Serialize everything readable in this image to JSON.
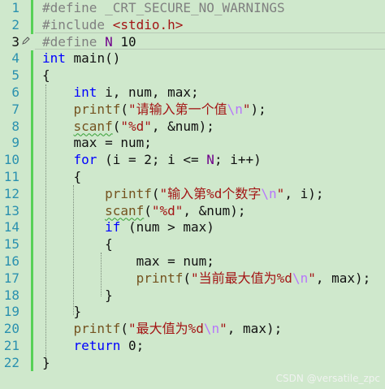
{
  "editor": {
    "line_numbers": [
      "1",
      "2",
      "3",
      "4",
      "5",
      "6",
      "7",
      "8",
      "9",
      "10",
      "11",
      "12",
      "13",
      "14",
      "15",
      "16",
      "17",
      "18",
      "19",
      "20",
      "21",
      "22"
    ],
    "active_line": 3,
    "lines": [
      [
        {
          "t": "#define _CRT_SECURE_NO_WARNINGS",
          "c": "pp"
        }
      ],
      [
        {
          "t": "#include ",
          "c": "pp"
        },
        {
          "t": "<stdio.h>",
          "c": "str"
        }
      ],
      [
        {
          "t": "#define ",
          "c": "pp"
        },
        {
          "t": "N",
          "c": "mac"
        },
        {
          "t": " 10",
          "c": "num"
        }
      ],
      [
        {
          "t": "int",
          "c": "kw"
        },
        {
          "t": " main()",
          "c": ""
        }
      ],
      [
        {
          "t": "{",
          "c": ""
        }
      ],
      [
        {
          "t": "    ",
          "c": ""
        },
        {
          "t": "int",
          "c": "kw"
        },
        {
          "t": " i, num, max;",
          "c": ""
        }
      ],
      [
        {
          "t": "    ",
          "c": ""
        },
        {
          "t": "printf",
          "c": "fn"
        },
        {
          "t": "(",
          "c": ""
        },
        {
          "t": "\"请输入第一个值",
          "c": "str"
        },
        {
          "t": "\\n",
          "c": "esc"
        },
        {
          "t": "\"",
          "c": "str"
        },
        {
          "t": ");",
          "c": ""
        }
      ],
      [
        {
          "t": "    ",
          "c": ""
        },
        {
          "t": "scanf",
          "c": "fn squig"
        },
        {
          "t": "(",
          "c": ""
        },
        {
          "t": "\"%d\"",
          "c": "str"
        },
        {
          "t": ", &num);",
          "c": ""
        }
      ],
      [
        {
          "t": "    max = num;",
          "c": ""
        }
      ],
      [
        {
          "t": "    ",
          "c": ""
        },
        {
          "t": "for",
          "c": "kw"
        },
        {
          "t": " (i = 2; i <= ",
          "c": ""
        },
        {
          "t": "N",
          "c": "mac"
        },
        {
          "t": "; i++)",
          "c": ""
        }
      ],
      [
        {
          "t": "    {",
          "c": ""
        }
      ],
      [
        {
          "t": "        ",
          "c": ""
        },
        {
          "t": "printf",
          "c": "fn"
        },
        {
          "t": "(",
          "c": ""
        },
        {
          "t": "\"输入第%d个数字",
          "c": "str"
        },
        {
          "t": "\\n",
          "c": "esc"
        },
        {
          "t": "\"",
          "c": "str"
        },
        {
          "t": ", i);",
          "c": ""
        }
      ],
      [
        {
          "t": "        ",
          "c": ""
        },
        {
          "t": "scanf",
          "c": "fn squig"
        },
        {
          "t": "(",
          "c": ""
        },
        {
          "t": "\"%d\"",
          "c": "str"
        },
        {
          "t": ", &num);",
          "c": ""
        }
      ],
      [
        {
          "t": "        ",
          "c": ""
        },
        {
          "t": "if",
          "c": "kw"
        },
        {
          "t": " (num > max)",
          "c": ""
        }
      ],
      [
        {
          "t": "        {",
          "c": ""
        }
      ],
      [
        {
          "t": "            max = num;",
          "c": ""
        }
      ],
      [
        {
          "t": "            ",
          "c": ""
        },
        {
          "t": "printf",
          "c": "fn"
        },
        {
          "t": "(",
          "c": ""
        },
        {
          "t": "\"当前最大值为%d",
          "c": "str"
        },
        {
          "t": "\\n",
          "c": "esc"
        },
        {
          "t": "\"",
          "c": "str"
        },
        {
          "t": ", max);",
          "c": ""
        }
      ],
      [
        {
          "t": "        }",
          "c": ""
        }
      ],
      [
        {
          "t": "    }",
          "c": ""
        }
      ],
      [
        {
          "t": "    ",
          "c": ""
        },
        {
          "t": "printf",
          "c": "fn"
        },
        {
          "t": "(",
          "c": ""
        },
        {
          "t": "\"最大值为%d",
          "c": "str"
        },
        {
          "t": "\\n",
          "c": "esc"
        },
        {
          "t": "\"",
          "c": "str"
        },
        {
          "t": ", max);",
          "c": ""
        }
      ],
      [
        {
          "t": "    ",
          "c": ""
        },
        {
          "t": "return",
          "c": "kw"
        },
        {
          "t": " 0;",
          "c": ""
        }
      ],
      [
        {
          "t": "}",
          "c": ""
        }
      ]
    ]
  },
  "icons": {
    "edit_marker": "pencil-icon"
  },
  "colors": {
    "background": "#cfe8cc",
    "keyword": "#0000ff",
    "string": "#a31515",
    "preprocessor": "#808080",
    "line_number": "#2b91af",
    "change_bar": "#57d157"
  },
  "watermark": "CSDN @versatile_zpc"
}
